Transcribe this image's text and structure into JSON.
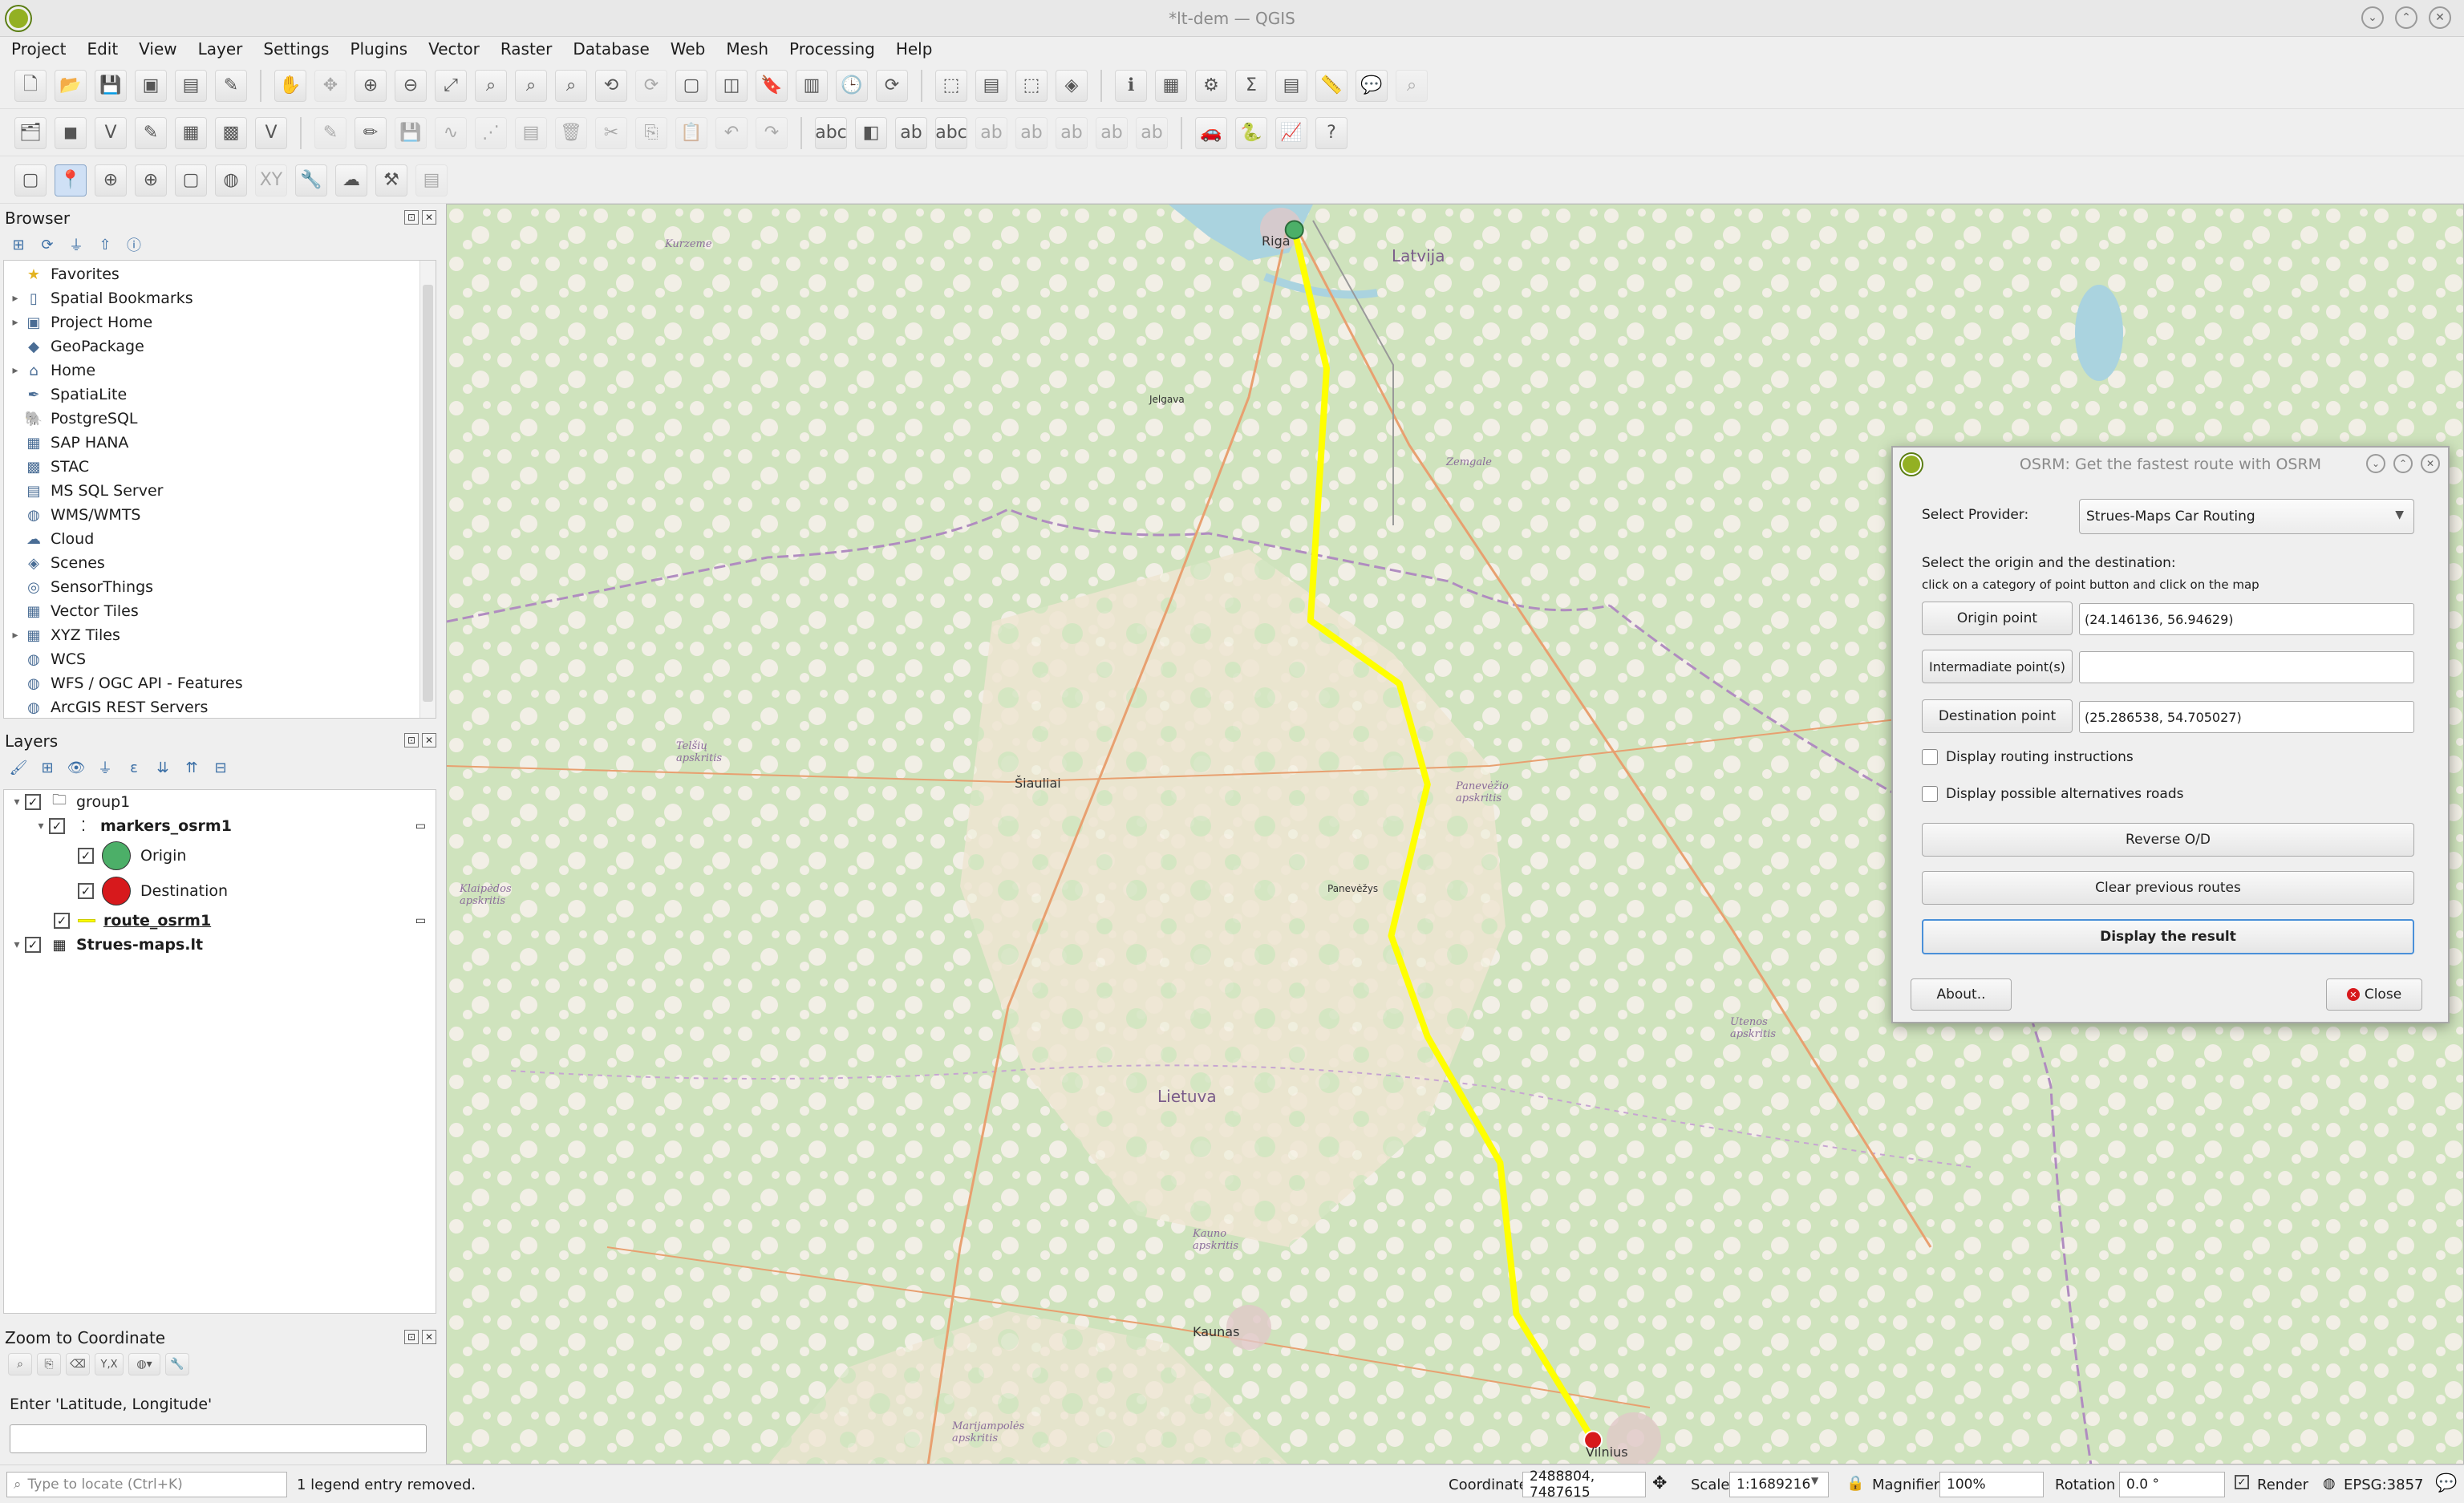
{
  "window": {
    "title": "*lt-dem — QGIS"
  },
  "menu": [
    "Project",
    "Edit",
    "View",
    "Layer",
    "Settings",
    "Plugins",
    "Vector",
    "Raster",
    "Database",
    "Web",
    "Mesh",
    "Processing",
    "Help"
  ],
  "browser": {
    "title": "Browser",
    "items": [
      {
        "label": "Favorites",
        "icon": "star-icon",
        "expand": false
      },
      {
        "label": "Spatial Bookmarks",
        "icon": "bookmark-icon",
        "expand": true
      },
      {
        "label": "Project Home",
        "icon": "project-home-icon",
        "expand": true
      },
      {
        "label": "GeoPackage",
        "icon": "geopackage-icon",
        "expand": false
      },
      {
        "label": "Home",
        "icon": "home-icon",
        "expand": true
      },
      {
        "label": "SpatiaLite",
        "icon": "spatialite-icon",
        "expand": false
      },
      {
        "label": "PostgreSQL",
        "icon": "postgresql-icon",
        "expand": false
      },
      {
        "label": "SAP HANA",
        "icon": "sap-hana-icon",
        "expand": false
      },
      {
        "label": "STAC",
        "icon": "stac-icon",
        "expand": false
      },
      {
        "label": "MS SQL Server",
        "icon": "mssql-icon",
        "expand": false
      },
      {
        "label": "WMS/WMTS",
        "icon": "wms-icon",
        "expand": false
      },
      {
        "label": "Cloud",
        "icon": "cloud-icon",
        "expand": false
      },
      {
        "label": "Scenes",
        "icon": "scenes-icon",
        "expand": false
      },
      {
        "label": "SensorThings",
        "icon": "sensorthings-icon",
        "expand": false
      },
      {
        "label": "Vector Tiles",
        "icon": "vector-tiles-icon",
        "expand": false
      },
      {
        "label": "XYZ Tiles",
        "icon": "xyz-tiles-icon",
        "expand": true
      },
      {
        "label": "WCS",
        "icon": "wcs-icon",
        "expand": false
      },
      {
        "label": "WFS / OGC API - Features",
        "icon": "wfs-icon",
        "expand": false
      },
      {
        "label": "ArcGIS REST Servers",
        "icon": "arcgis-icon",
        "expand": false
      }
    ]
  },
  "layers": {
    "title": "Layers",
    "group": "group1",
    "markers": "markers_osrm1",
    "origin": "Origin",
    "destination": "Destination",
    "route": "route_osrm1",
    "basemap": "Strues-maps.lt",
    "origin_color": "#4caf68",
    "destination_color": "#d7191c",
    "route_color": "#ffff00"
  },
  "zoom": {
    "title": "Zoom to Coordinate",
    "prompt": "Enter 'Latitude, Longitude'",
    "value": ""
  },
  "map": {
    "countries": [
      "Latvija",
      "Lietuva"
    ],
    "cities": [
      "Riga",
      "Jelgava",
      "Šiauliai",
      "Panevėžys",
      "Kaunas",
      "Vilnius"
    ],
    "regions": [
      "Kurzeme",
      "Zemgale",
      "Telšių apskritis",
      "Panevėžio apskritis",
      "Klaipėdos apskritis",
      "Utenos apskritis",
      "Kauno apskritis",
      "Marijampolės apskritis"
    ],
    "route_points": [
      [
        0.42,
        0.02
      ],
      [
        0.436,
        0.13
      ],
      [
        0.428,
        0.33
      ],
      [
        0.472,
        0.38
      ],
      [
        0.486,
        0.46
      ],
      [
        0.468,
        0.58
      ],
      [
        0.486,
        0.66
      ],
      [
        0.522,
        0.76
      ],
      [
        0.53,
        0.88
      ],
      [
        0.568,
        0.98
      ]
    ]
  },
  "dialog": {
    "title": "OSRM: Get the fastest route with OSRM",
    "provider_label": "Select Provider:",
    "provider_value": "Strues-Maps Car Routing",
    "instructions_line1": "Select the origin and the destination:",
    "instructions_line2": "click on a category of point button and click on the map",
    "origin_button": "Origin point",
    "origin_value": "(24.146136, 56.94629)",
    "intermediate_button": "Intermadiate point(s)",
    "intermediate_value": "",
    "destination_button": "Destination point",
    "destination_value": "(25.286538, 54.705027)",
    "chk_instructions": "Display routing instructions",
    "chk_alternatives": "Display possible alternatives roads",
    "reverse": "Reverse O/D",
    "clear": "Clear previous routes",
    "display": "Display the result",
    "about": "About..",
    "close": "Close"
  },
  "status": {
    "locate_placeholder": "Type to locate (Ctrl+K)",
    "message": "1 legend entry removed.",
    "coordinate_label": "Coordinate",
    "coordinate_value": "2488804, 7487615",
    "scale_label": "Scale",
    "scale_value": "1:1689216",
    "magnifier_label": "Magnifier",
    "magnifier_value": "100%",
    "rotation_label": "Rotation",
    "rotation_value": "0.0 °",
    "render_label": "Render",
    "crs": "EPSG:3857"
  }
}
